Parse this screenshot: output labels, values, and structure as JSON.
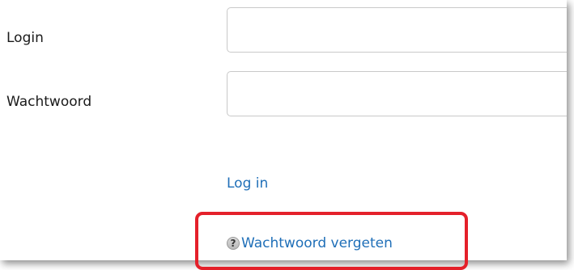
{
  "form": {
    "login_label": "Login",
    "login_value": "",
    "password_label": "Wachtwoord",
    "password_value": ""
  },
  "actions": {
    "login_link": "Log in",
    "forgot_link": "Wachtwoord vergeten",
    "help_icon": "?"
  },
  "colors": {
    "link": "#1f6fb8",
    "highlight": "#e4202a"
  },
  "icons": {
    "help": "question-circle-icon"
  }
}
